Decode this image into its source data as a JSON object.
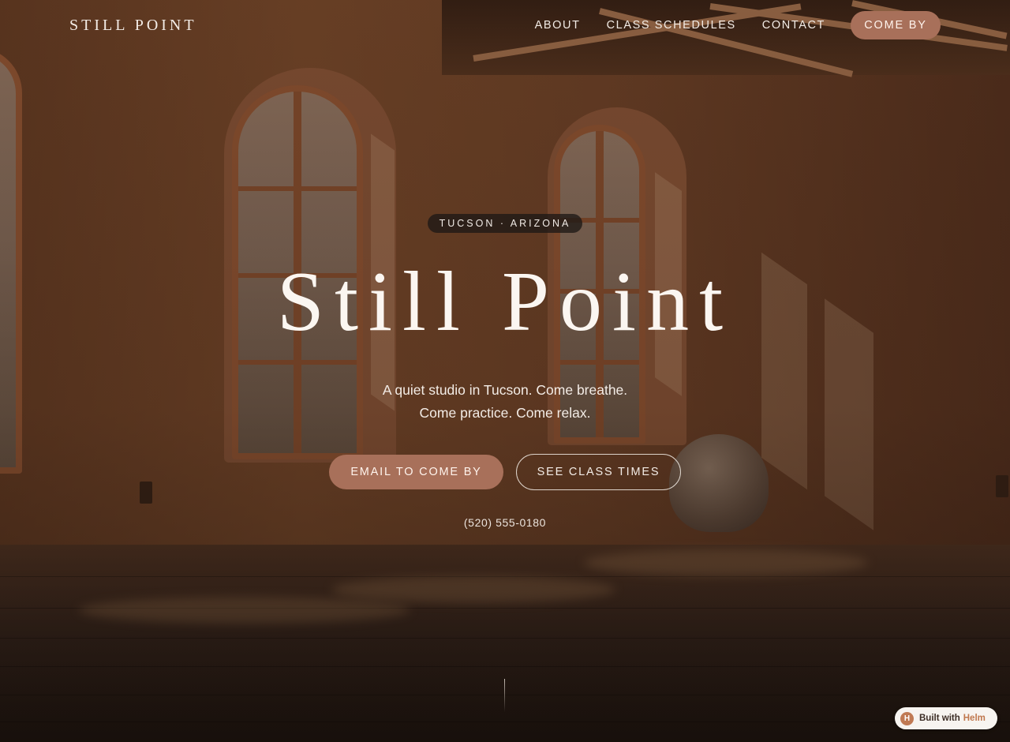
{
  "header": {
    "brand": "STILL POINT",
    "nav": [
      "ABOUT",
      "CLASS SCHEDULES",
      "CONTACT"
    ],
    "cta": "COME BY"
  },
  "hero": {
    "location": "TUCSON · ARIZONA",
    "title": "Still Point",
    "subtitle_line1": "A quiet studio in Tucson. Come breathe.",
    "subtitle_line2": "Come practice. Come relax.",
    "primary_button": "EMAIL TO COME BY",
    "secondary_button": "SEE CLASS TIMES",
    "phone": "(520) 555-0180"
  },
  "badge": {
    "logo_letter": "H",
    "text": "Built with",
    "brand": "Helm"
  },
  "colors": {
    "accent": "#a8705a",
    "text_light": "#f3ece6"
  }
}
